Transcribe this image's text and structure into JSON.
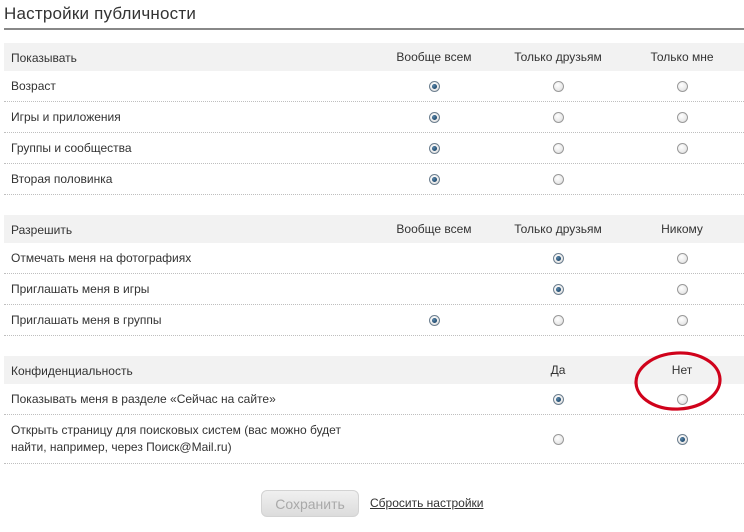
{
  "page": {
    "title": "Настройки публичности"
  },
  "sections": {
    "show": {
      "header": "Показывать",
      "col1": "Вообще всем",
      "col2": "Только друзьям",
      "col3": "Только мне",
      "rows": [
        {
          "label": "Возраст",
          "selected": "col1"
        },
        {
          "label": "Игры и приложения",
          "selected": "col1"
        },
        {
          "label": "Группы и сообщества",
          "selected": "col1"
        },
        {
          "label": "Вторая половинка",
          "selected": "col1"
        }
      ]
    },
    "allow": {
      "header": "Разрешить",
      "col1": "Вообще всем",
      "col2": "Только друзьям",
      "col3": "Никому",
      "rows": [
        {
          "label": "Отмечать меня на фотографиях",
          "selected": "col2"
        },
        {
          "label": "Приглашать меня в игры",
          "selected": "col2"
        },
        {
          "label": "Приглашать меня в группы",
          "selected": "col1"
        }
      ]
    },
    "privacy": {
      "header": "Конфиденциальность",
      "col2": "Да",
      "col3": "Нет",
      "rows": [
        {
          "label": "Показывать меня в разделе «Сейчас на сайте»",
          "selected": "col2"
        },
        {
          "label_line1": "Открыть страницу для поисковых систем (вас можно будет",
          "label_line2": "найти, например, через Поиск@Mail.ru)",
          "selected": "col3"
        }
      ]
    }
  },
  "actions": {
    "save_label": "Сохранить",
    "reset_label": "Сбросить настройки"
  },
  "colors": {
    "header_bg": "#f2f2f2",
    "annotation": "#d0021b",
    "radio_checked": "#1f4a6e"
  }
}
